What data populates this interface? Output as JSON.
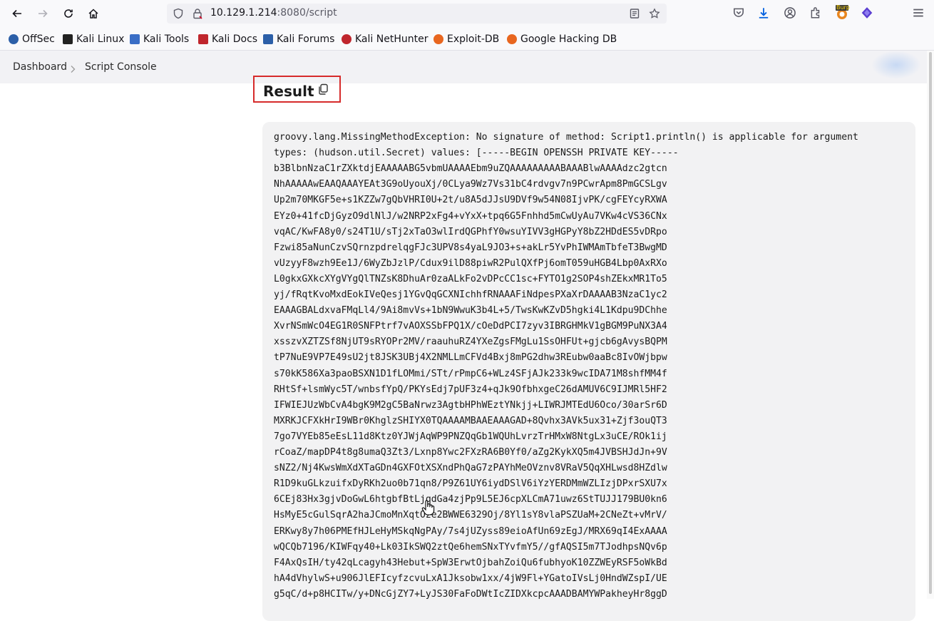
{
  "browser": {
    "url_host": "10.129.1.214",
    "url_rest": ":8080/script",
    "burp_badge": "Burp",
    "icons": [
      "back-icon",
      "forward-icon",
      "reload-icon",
      "home-icon",
      "shield-icon",
      "lock-icon",
      "reader-icon",
      "star-icon",
      "pocket-icon",
      "download-icon",
      "account-icon",
      "extensions-icon",
      "burp-icon",
      "proton-icon",
      "menu-icon"
    ]
  },
  "bookmarks": [
    {
      "label": "OffSec",
      "color": "#2c5fa8"
    },
    {
      "label": "Kali Linux",
      "color": "#222222"
    },
    {
      "label": "Kali Tools",
      "color": "#3a6ec6"
    },
    {
      "label": "Kali Docs",
      "color": "#c0262d"
    },
    {
      "label": "Kali Forums",
      "color": "#2c5fa8"
    },
    {
      "label": "Kali NetHunter",
      "color": "#c0262d"
    },
    {
      "label": "Exploit-DB",
      "color": "#e8661f"
    },
    {
      "label": "Google Hacking DB",
      "color": "#e8661f"
    }
  ],
  "breadcrumb": {
    "dashboard": "Dashboard",
    "current": "Script Console"
  },
  "result": {
    "title": "Result",
    "accent": "#d62b2b"
  },
  "output_lines": [
    "groovy.lang.MissingMethodException: No signature of method: Script1.println() is applicable for argument",
    "types: (hudson.util.Secret) values: [-----BEGIN OPENSSH PRIVATE KEY-----",
    "b3BlbnNzaC1rZXktdjEAAAAABG5vbmUAAAAEbm9uZQAAAAAAAAABAAABlwAAAAdzc2gtcn",
    "NhAAAAAwEAAQAAAYEAt3G9oUyouXj/0CLya9Wz7Vs31bC4rdvgv7n9PCwrApm8PmGCSLgv",
    "Up2m70MKGF5e+s1KZZw7gQbVHRI0U+2t/u8A5dJJsU9DVf9w54N08IjvPK/cgFEYcyRXWA",
    "EYz0+41fcDjGyzO9dlNlJ/w2NRP2xFg4+vYxX+tpq6G5Fnhhd5mCwUyAu7VKw4cVS36CNx",
    "vqAC/KwFA8y0/s24T1U/sTj2xTaO3wlIrdQGPhfY0wsuYIVV3gHGPyY8bZ2HDdES5vDRpo",
    "Fzwi85aNunCzvSQrnzpdrelqgFJc3UPV8s4yaL9JO3+s+akLr5YvPhIWMAmTbfeT3BwgMD",
    "vUzyyF8wzh9Ee1J/6WyZbJzlP/Cdux9ilD88piwR2PulQXfPj6omT059uHGB4Lbp0AxRXo",
    "L0gkxGXkcXYgVYgQlTNZsK8DhuAr0zaALkFo2vDPcCC1sc+FYTO1g2SOP4shZEkxMR1To5",
    "yj/fRqtKvoMxdEokIVeQesj1YGvQqGCXNIchhfRNAAAFiNdpesPXaXrDAAAAB3NzaC1yc2",
    "EAAAGBALdxvaFMqLl4/9Ai8mvVs+1bN9WwuK3b4L+5/TwsKwKZvD5hgki4L1Kdpu9DChhe",
    "XvrNSmWcO4EG1R0SNFPtrf7vAOXSSbFPQ1X/cOeDdPCI7zyv3IBRGHMkV1gBGM9PuNX3A4",
    "xsszvXZTZSf8NjUT9sRYOPr2MV/raauhuRZ4YXeZgsFMgLu1SsOHFUt+gjcb6gAvysBQPM",
    "tP7NuE9VP7E49sU2jt8JSK3UBj4X2NMLLmCFVd4Bxj8mPG2dhw3REubw0aaBc8IvOWjbpw",
    "s70kK586Xa3paoBSXN1D1fLOMmi/STt/rPmpC6+WLz4SFjAJk233k9wcIDA71M8shfMM4f",
    "RHtSf+lsmWyc5T/wnbsfYpQ/PKYsEdj7pUF3z4+qJk9OfbhxgeC26dAMUV6C9IJMRl5HF2",
    "IFWIEJUzWbCvA4bgK9M2gC5BaNrwz3AgtbHPhWEztYNkjj+LIWRJMTEdU6Oco/30arSr6D",
    "MXRKJCFXkHrI9WBr0KhglzSHIYX0TQAAAAMBAAEAAAGAD+8Qvhx3AVk5ux31+Zjf3ouQT3",
    "7go7VYEb85eEsL11d8Ktz0YJWjAqWP9PNZQqGb1WQUhLvrzTrHMxW8NtgLx3uCE/ROk1ij",
    "rCoaZ/mapDP4t8g8umaQ3Zt3/Lxnp8Ywc2FXzRA6B0Yf0/aZg2KykXQ5m4JVBSHJdJn+9V",
    "sNZ2/Nj4KwsWmXdXTaGDn4GXFOtXSXndPhQaG7zPAYhMeOVznv8VRaV5QqXHLwsd8HZdlw",
    "R1D9kuGLkzuifxDyRKh2uo0b71qn8/P9Z61UY6iydDSlV6iYzYERDMmWZLIzjDPxrSXU7x",
    "6CEj83Hx3gjvDoGwL6htgbfBtLjqdGa4zjPp9L5EJ6cpXLCmA71uwz6StTUJJ179BU0kn6",
    "HsMyE5cGulSqrA2haJCmoMnXqtOze2BWWE6329Oj/8Yl1sY8vlaPSZUaM+2CNeZt+vMrV/",
    "ERKwy8y7h06PMEfHJLeHyMSkqNgPAy/7s4jUZyss89eioAfUn69zEgJ/MRX69qI4ExAAAA",
    "wQCQb7196/KIWFqy40+Lk03IkSWQ2ztQe6hemSNxTYvfmY5//gfAQSI5m7TJodhpsNQv6p",
    "F4AxQsIH/ty42qLcagyh43Hebut+SpW3ErwtOjbahZoiQu6fubhyoK10ZZWEyRSF5oWkBd",
    "hA4dVhylwS+u906JlEFIcyfzcvuLxA1Jksobw1xx/4jW9Fl+YGatoIVsLj0HndWZspI/UE",
    "g5qC/d+p8HCITw/y+DNcGjZY7+LyJS30FaFoDWtIcZIDXkcpcAAADBAMYWPakheyHr8ggD"
  ]
}
